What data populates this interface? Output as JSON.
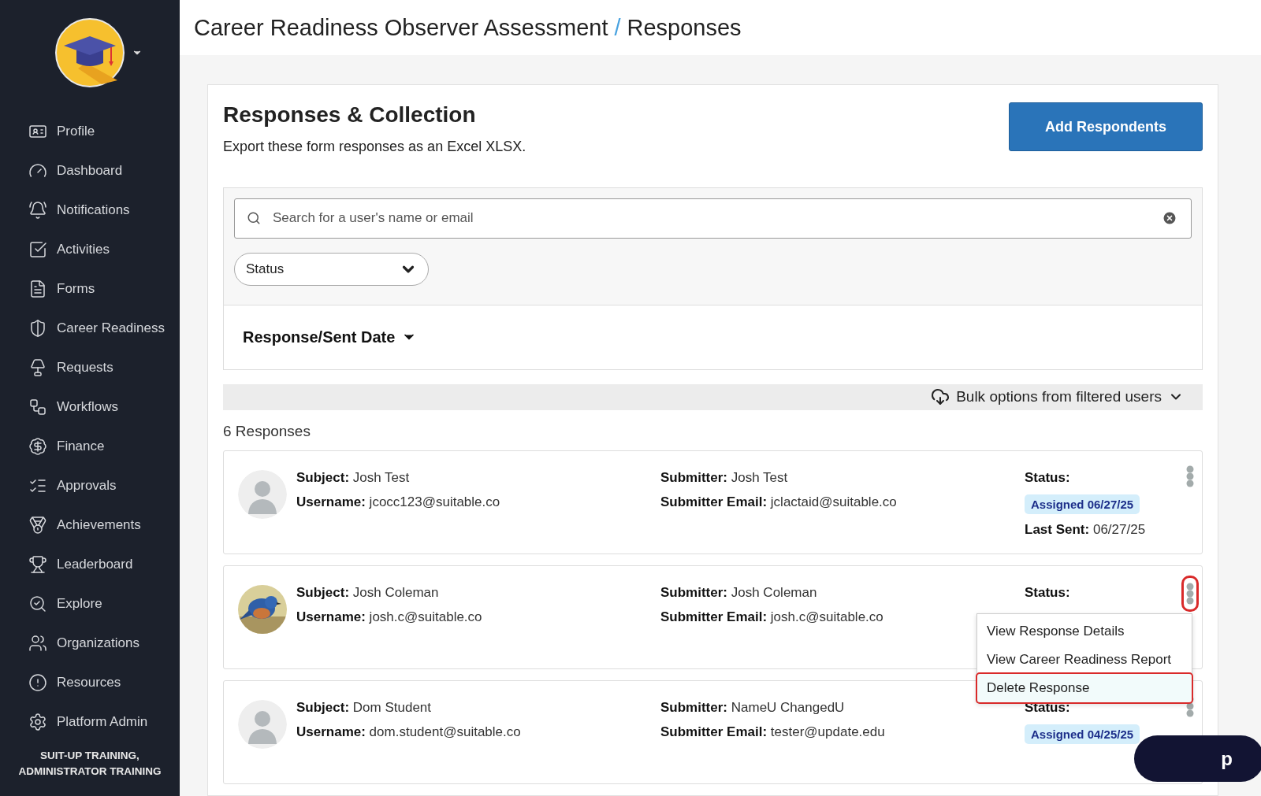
{
  "header": {
    "title": "Career Readiness Observer Assessment",
    "separator": "/",
    "page": "Responses"
  },
  "sidebar": {
    "items": [
      {
        "label": "Profile"
      },
      {
        "label": "Dashboard"
      },
      {
        "label": "Notifications"
      },
      {
        "label": "Activities"
      },
      {
        "label": "Forms"
      },
      {
        "label": "Career Readiness"
      },
      {
        "label": "Requests"
      },
      {
        "label": "Workflows"
      },
      {
        "label": "Finance"
      },
      {
        "label": "Approvals"
      },
      {
        "label": "Achievements"
      },
      {
        "label": "Leaderboard"
      },
      {
        "label": "Explore"
      },
      {
        "label": "Organizations"
      },
      {
        "label": "Resources"
      },
      {
        "label": "Platform Admin"
      }
    ],
    "org": "SUIT-UP TRAINING, ADMINISTRATOR TRAINING"
  },
  "panel": {
    "title": "Responses & Collection",
    "subtitle": "Export these form responses as an Excel XLSX.",
    "button": "Add Respondents",
    "search": {
      "placeholder": "Search for a user's name or email"
    },
    "status_filter": "Status",
    "sort": "Response/Sent Date",
    "bulk": "Bulk options from filtered users",
    "count": "6 Responses",
    "responses": [
      {
        "photo": false,
        "subject": [
          {
            "label": "Subject:",
            "value": "Josh Test"
          },
          {
            "label": "Username:",
            "value": "jcocc123@suitable.co"
          }
        ],
        "submitter": [
          {
            "label": "Submitter:",
            "value": "Josh Test"
          },
          {
            "label": "Submitter Email:",
            "value": "jclactaid@suitable.co"
          }
        ],
        "status_label": "Status:",
        "badge": "Assigned 06/27/25",
        "last_sent": {
          "label": "Last Sent:",
          "value": "06/27/25"
        },
        "menu_open": false
      },
      {
        "photo": true,
        "subject": [
          {
            "label": "Subject:",
            "value": "Josh Coleman"
          },
          {
            "label": "Username:",
            "value": "josh.c@suitable.co"
          }
        ],
        "submitter": [
          {
            "label": "Submitter:",
            "value": "Josh Coleman"
          },
          {
            "label": "Submitter Email:",
            "value": "josh.c@suitable.co"
          }
        ],
        "status_label": "Status:",
        "menu_open": true,
        "menu": [
          {
            "label": "View Response Details",
            "selected": false
          },
          {
            "label": "View Career Readiness Report",
            "selected": false
          },
          {
            "label": "Delete Response",
            "selected": true
          }
        ]
      },
      {
        "photo": false,
        "subject": [
          {
            "label": "Subject:",
            "value": "Dom Student"
          },
          {
            "label": "Username:",
            "value": "dom.student@suitable.co"
          }
        ],
        "submitter": [
          {
            "label": "Submitter:",
            "value": "NameU ChangedU"
          },
          {
            "label": "Submitter Email:",
            "value": "tester@update.edu"
          }
        ],
        "status_label": "Status:",
        "badge": "Assigned 04/25/25",
        "menu_open": false
      }
    ]
  },
  "help_button": {
    "label": "p"
  }
}
